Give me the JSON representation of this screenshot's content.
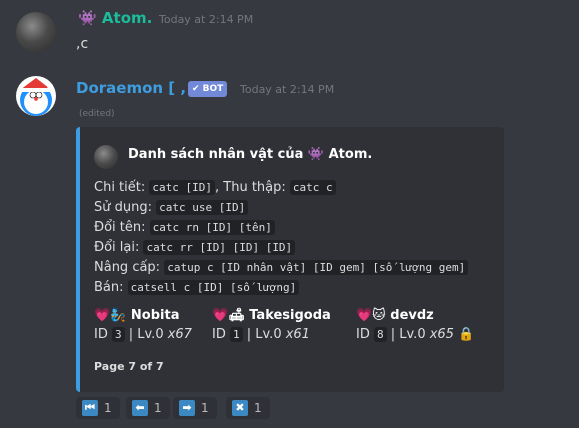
{
  "messages": [
    {
      "username": "Atom.",
      "user_emoji": "👾",
      "username_color": "#1abc9c",
      "timestamp": "Today at 2:14 PM",
      "text": ",c"
    },
    {
      "username": "Doraemon [ , ]",
      "username_color": "#3e9de1",
      "bot_tag": "✔ BOT",
      "timestamp": "Today at 2:14 PM",
      "edited": "(edited)"
    }
  ],
  "embed": {
    "accent_color": "#3e9de1",
    "author": "Danh sách nhân vật của 👾 Atom.",
    "desc": [
      {
        "a": "Chi tiết: ",
        "b": "catc [ID]",
        "c": ", Thu thập: ",
        "d": "catc c"
      },
      {
        "a": "Sử dụng: ",
        "b": "catc use [ID]"
      },
      {
        "a": "Đổi tên: ",
        "b": "catc rn [ID] [tên]"
      },
      {
        "a": "Đổi lại: ",
        "b": "catc rr [ID] [ID] [ID]"
      },
      {
        "a": "Nâng cấp: ",
        "b": "catup c [ID nhân vật] [ID gem] [số lượng gem]"
      },
      {
        "a": "Bán: ",
        "b": "catsell c [ID] [số lượng]"
      }
    ],
    "fields": [
      {
        "icons": "💗🧞",
        "name": "Nobita",
        "id_label": "ID ",
        "id": "3",
        "level": " | Lv.0 ",
        "count": "x67",
        "extra": ""
      },
      {
        "icons": "💗🛋",
        "name": "Takesigoda",
        "id_label": "ID ",
        "id": "1",
        "level": " | Lv.0 ",
        "count": "x61",
        "extra": ""
      },
      {
        "icons": "💗🐱",
        "name": "devdz",
        "id_label": "ID ",
        "id": "8",
        "level": " | Lv.0 ",
        "count": "x65",
        "extra": "🔒"
      }
    ],
    "footer": "Page 7 of 7"
  },
  "reactions": [
    {
      "icon": "first-page-icon",
      "glyph": "⏮",
      "count": "1"
    },
    {
      "icon": "previous-icon",
      "glyph": "⬅",
      "count": "1"
    },
    {
      "icon": "next-icon",
      "glyph": "➡",
      "count": "1"
    },
    {
      "icon": "close-icon",
      "glyph": "✖",
      "count": "1"
    }
  ]
}
